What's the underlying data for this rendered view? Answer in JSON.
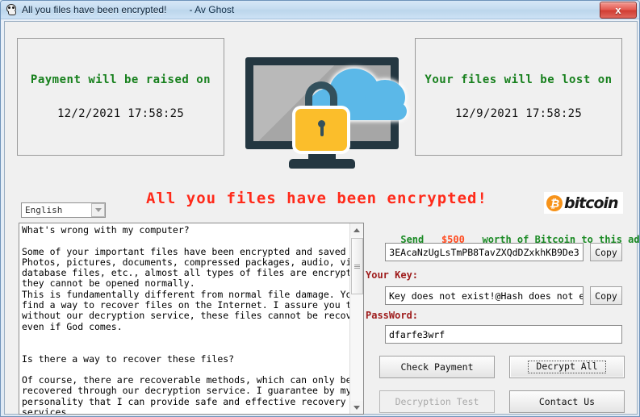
{
  "window": {
    "title": "All you files have been encrypted!",
    "subtitle": "- Av Ghost",
    "close_label": "x"
  },
  "panels": {
    "left": {
      "heading": "Payment will be raised on",
      "date": "12/2/2021 17:58:25"
    },
    "right": {
      "heading": "Your files will be lost on",
      "date": "12/9/2021 17:58:25"
    }
  },
  "headline": "All you files have been encrypted!",
  "bitcoin_logo": {
    "symbol": "₿",
    "word": "bitcoin",
    "color": "#f7931a"
  },
  "language": {
    "selected": "English",
    "options": [
      "English"
    ]
  },
  "note": "What's wrong with my computer?\n\nSome of your important files have been encrypted and saved by me.\nPhotos, pictures, documents, compressed packages, audio, video,\ndatabase files, etc., almost all types of files are encrypted, so\nthey cannot be opened normally.\nThis is fundamentally different from normal file damage. You cannot\nfind a way to recover files on the Internet. I assure you that\nwithout our decryption service, these files cannot be recovered\neven if God comes.\n\n\nIs there a way to recover these files?\n\nOf course, there are recoverable methods, which can only be\nrecovered through our decryption service. I guarantee by my\npersonality that I can provide safe and effective recovery\nservices.\nBut this is chargeable and cannot be postponed indefinitely.",
  "payment": {
    "send_prefix": "Send",
    "amount": "$500",
    "send_suffix": "worth of Bitcoin to this address:",
    "address": "3EAcaNzUgLsTmPB8TavZXQdDZxkhKB9De3",
    "address_copy_label": "Copy",
    "key_label": "Your Key:",
    "key_value": "Key does not exist!@Hash does not exist!",
    "key_copy_label": "Copy",
    "password_label": "PassWord:",
    "password_value": "dfarfe3wrf"
  },
  "buttons": {
    "check_payment": "Check Payment",
    "decrypt_all": "Decrypt All",
    "decryption_test": "Decryption Test",
    "contact_us": "Contact Us"
  }
}
